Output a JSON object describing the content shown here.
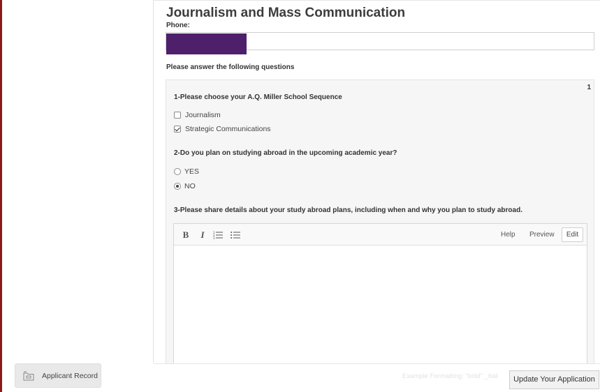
{
  "page": {
    "title": "Journalism and Mass Communication"
  },
  "phone": {
    "label": "Phone:",
    "value": ""
  },
  "questions": {
    "heading": "Please answer the following questions",
    "panel_number": "1",
    "q1": {
      "title": "1-Please choose your A.Q. Miller School Sequence",
      "options": [
        {
          "label": "Journalism",
          "checked": false
        },
        {
          "label": "Strategic Communications",
          "checked": true
        }
      ]
    },
    "q2": {
      "title": "2-Do you plan on studying abroad in the upcoming academic year?",
      "options": [
        {
          "label": "YES",
          "selected": false
        },
        {
          "label": "NO",
          "selected": true
        }
      ]
    },
    "q3": {
      "title": "3-Please share details about your study abroad plans, including when and why you plan to study abroad."
    }
  },
  "editor": {
    "bold": "B",
    "italic": "I",
    "help": "Help",
    "preview": "Preview",
    "edit": "Edit",
    "content": ""
  },
  "footer": {
    "formatting_hint": "Example Formatting: \"bold\" _itali",
    "update_button": "Update Your Application"
  },
  "sidebar": {
    "applicant_record": "Applicant Record"
  },
  "colors": {
    "accent_left_rule": "#8b1a1a",
    "redaction": "#4e1f6b",
    "panel_bg": "#f6f6f6"
  },
  "icons": {
    "bold": "bold-icon",
    "italic": "italic-icon",
    "ordered_list": "ordered-list-icon",
    "unordered_list": "unordered-list-icon",
    "record": "folder-record-icon"
  }
}
